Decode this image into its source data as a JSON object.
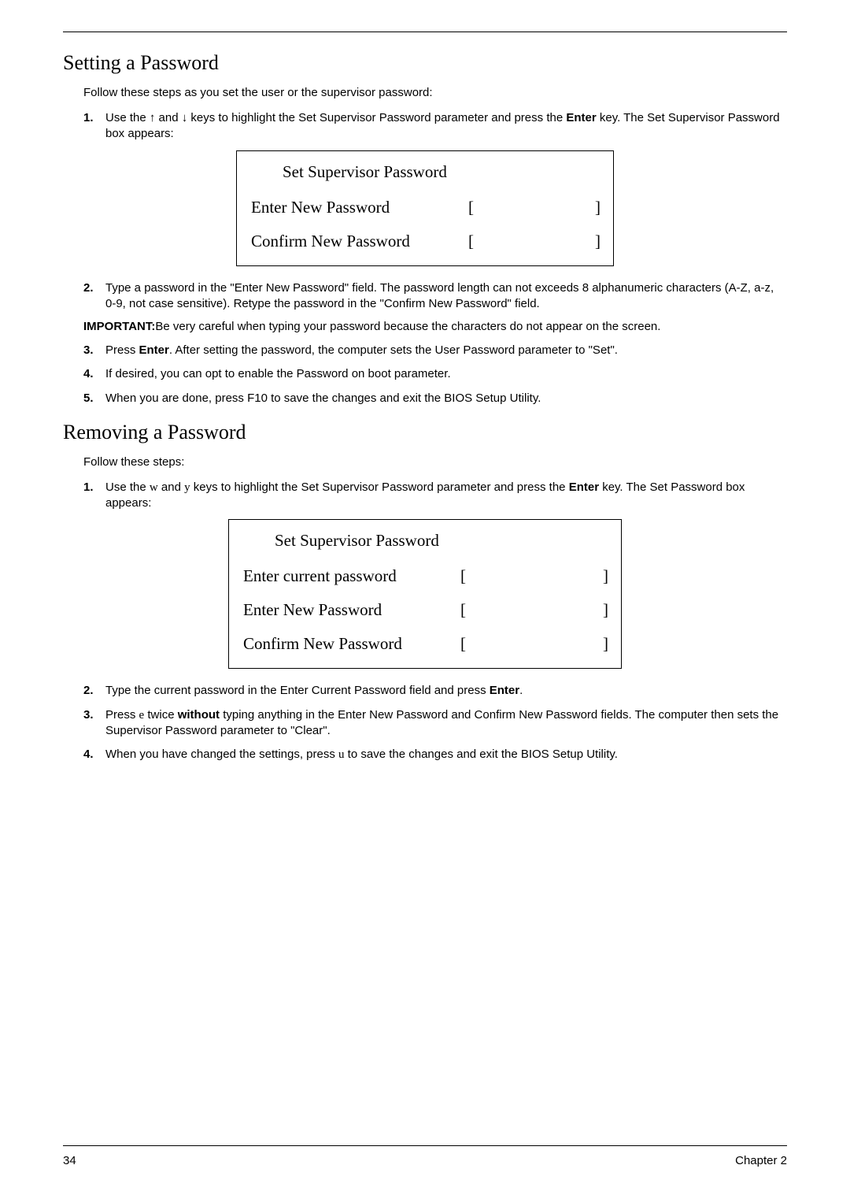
{
  "section1": {
    "heading": "Setting a Password",
    "intro": "Follow these steps as you set the user or the supervisor password:",
    "steps": [
      {
        "num": "1.",
        "pre": "Use the ",
        "arrows": true,
        "post": " keys to highlight the Set Supervisor Password parameter and press the ",
        "bold": "Enter",
        "tail": " key. The Set Supervisor Password box appears:"
      },
      {
        "num": "2.",
        "text": "Type a password in the \"Enter New Password\" field. The password length can not exceeds 8 alphanumeric characters (A-Z, a-z, 0-9, not case sensitive). Retype the password in the \"Confirm New Password\" field."
      },
      {
        "num": "3.",
        "pre": "Press ",
        "bold": "Enter",
        "tail": ". After setting the password, the computer sets the User Password parameter to \"Set\"."
      },
      {
        "num": "4.",
        "text": "If desired, you can opt to enable the Password on boot parameter."
      },
      {
        "num": "5.",
        "text": "When you are done, press F10 to save the changes and exit the BIOS Setup Utility."
      }
    ],
    "important_label": "IMPORTANT:",
    "important_text": "Be very careful when typing your password because the characters do not appear on the screen.",
    "dialog": {
      "title": "Set Supervisor Password",
      "row1": "Enter New Password",
      "row2": "Confirm New Password"
    }
  },
  "section2": {
    "heading": "Removing a Password",
    "intro": "Follow these steps:",
    "steps": [
      {
        "num": "1.",
        "pre": "Use the ",
        "wy": true,
        "post": " keys to highlight the Set Supervisor Password parameter and press the ",
        "bold": "Enter",
        "tail": " key. The Set Password box appears:"
      },
      {
        "num": "2.",
        "pre": "Type the current password in the Enter Current Password field and press ",
        "bold": "Enter",
        "tail": "."
      },
      {
        "num": "3.",
        "pre": "Press ",
        "e_char": "e",
        "mid1": " twice ",
        "bold": "without",
        "tail": " typing anything in the Enter New Password and Confirm New Password fields. The computer then sets the Supervisor Password parameter to \"Clear\"."
      },
      {
        "num": "4.",
        "pre": "When you have changed the settings, press ",
        "u_char": "u",
        "tail": " to save the changes and exit the BIOS Setup Utility."
      }
    ],
    "dialog": {
      "title": "Set Supervisor Password",
      "row1": "Enter current password",
      "row2": "Enter New Password",
      "row3": "Confirm New Password"
    }
  },
  "footer": {
    "page": "34",
    "chapter": "Chapter 2"
  },
  "glyphs": {
    "up": "↑",
    "down": "↓",
    "and": " and ",
    "w": "w",
    "y": "y"
  }
}
